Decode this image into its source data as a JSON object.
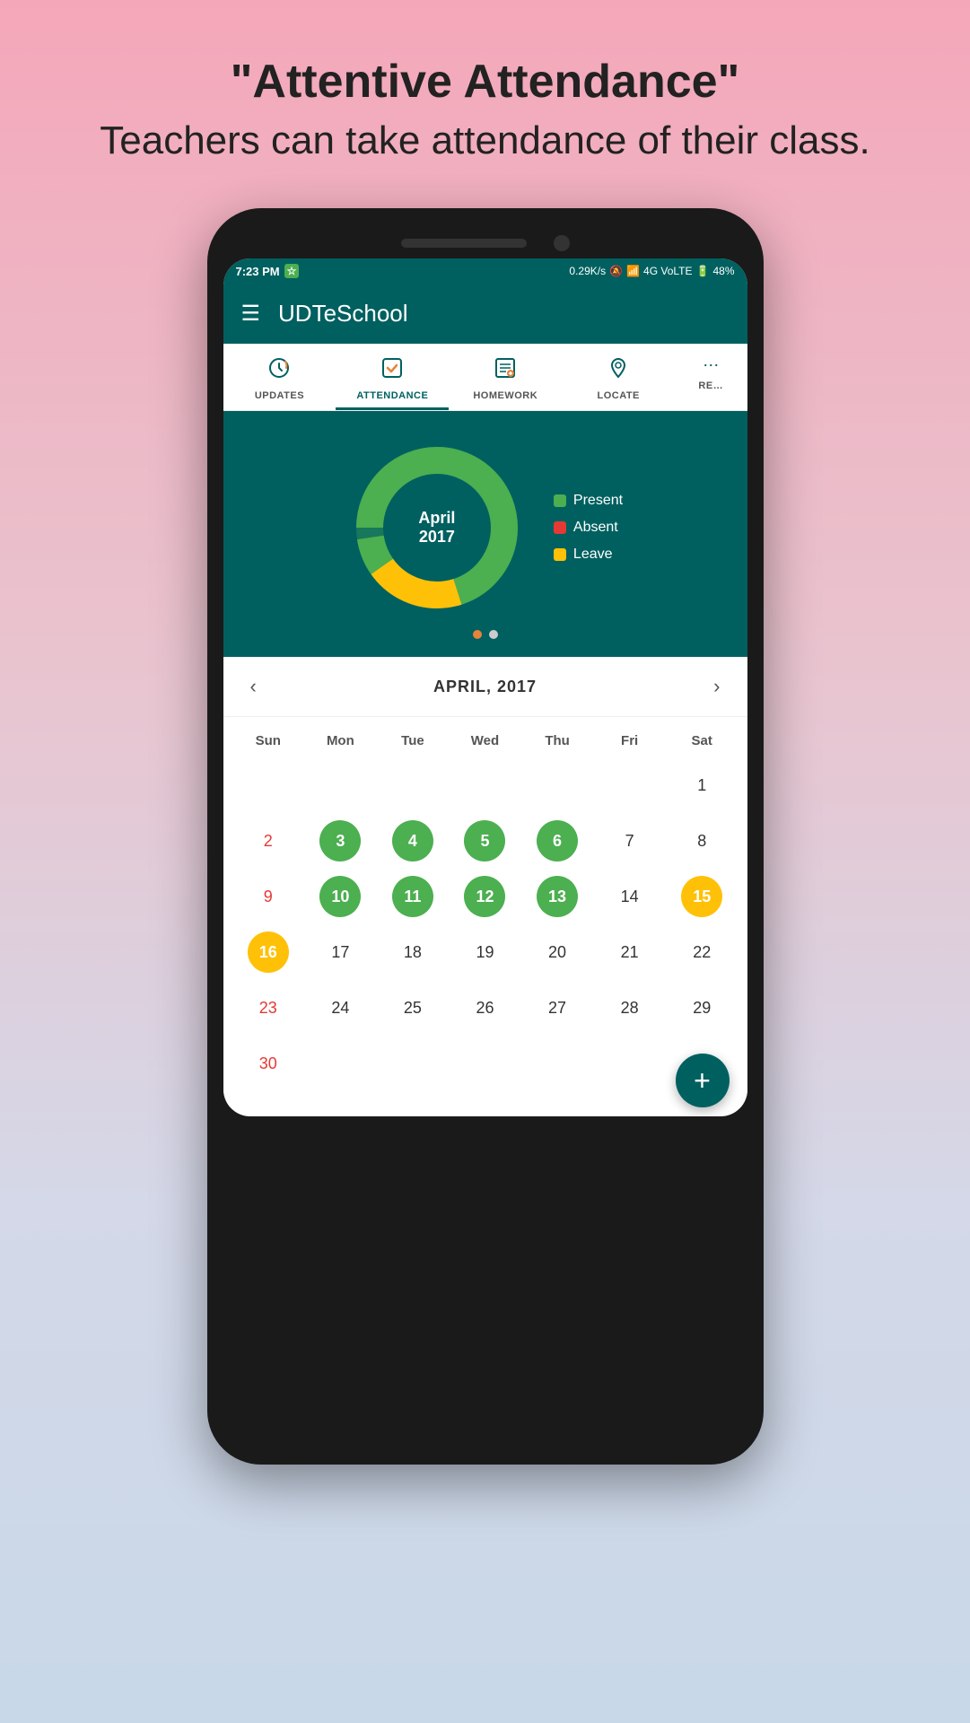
{
  "page": {
    "headline": "\"Attentive Attendance\"",
    "subheadline": "Teachers can take attendance of their class."
  },
  "status_bar": {
    "time": "7:23 PM",
    "signal_info": "0.29K/s",
    "network": "4G VoLTE",
    "battery": "48%"
  },
  "app": {
    "title": "UDTeSchool"
  },
  "nav_tabs": [
    {
      "id": "updates",
      "label": "UPDATES",
      "icon": "↻"
    },
    {
      "id": "attendance",
      "label": "ATTENDANCE",
      "icon": "✓"
    },
    {
      "id": "homework",
      "label": "HOMEWORK",
      "icon": "📋"
    },
    {
      "id": "locate",
      "label": "LOCATE",
      "icon": "📍"
    },
    {
      "id": "more",
      "label": "RE…",
      "icon": "≡"
    }
  ],
  "chart": {
    "month": "April",
    "year": "2017",
    "legend": [
      {
        "label": "Present",
        "color": "#4caf50"
      },
      {
        "label": "Absent",
        "color": "#e53935"
      },
      {
        "label": "Leave",
        "color": "#ffc107"
      }
    ],
    "dots": [
      true,
      false
    ]
  },
  "calendar": {
    "title": "APRIL, 2017",
    "prev_label": "‹",
    "next_label": "›",
    "headers": [
      "Sun",
      "Mon",
      "Tue",
      "Wed",
      "Thu",
      "Fri",
      "Sat"
    ],
    "weeks": [
      [
        {
          "day": "",
          "type": "empty"
        },
        {
          "day": "",
          "type": "empty"
        },
        {
          "day": "",
          "type": "empty"
        },
        {
          "day": "",
          "type": "empty"
        },
        {
          "day": "",
          "type": "empty"
        },
        {
          "day": "",
          "type": "empty"
        },
        {
          "day": "1",
          "type": "normal"
        }
      ],
      [
        {
          "day": "2",
          "type": "sunday"
        },
        {
          "day": "3",
          "type": "present"
        },
        {
          "day": "4",
          "type": "present"
        },
        {
          "day": "5",
          "type": "present"
        },
        {
          "day": "6",
          "type": "present"
        },
        {
          "day": "7",
          "type": "normal"
        },
        {
          "day": "8",
          "type": "normal"
        }
      ],
      [
        {
          "day": "9",
          "type": "sunday"
        },
        {
          "day": "10",
          "type": "present"
        },
        {
          "day": "11",
          "type": "present"
        },
        {
          "day": "12",
          "type": "present"
        },
        {
          "day": "13",
          "type": "present"
        },
        {
          "day": "14",
          "type": "normal"
        },
        {
          "day": "15",
          "type": "leave"
        }
      ],
      [
        {
          "day": "16",
          "type": "leave-sunday"
        },
        {
          "day": "17",
          "type": "normal"
        },
        {
          "day": "18",
          "type": "normal"
        },
        {
          "day": "19",
          "type": "normal"
        },
        {
          "day": "20",
          "type": "normal"
        },
        {
          "day": "21",
          "type": "normal"
        },
        {
          "day": "22",
          "type": "normal"
        }
      ],
      [
        {
          "day": "23",
          "type": "sunday"
        },
        {
          "day": "24",
          "type": "normal"
        },
        {
          "day": "25",
          "type": "normal"
        },
        {
          "day": "26",
          "type": "normal"
        },
        {
          "day": "27",
          "type": "normal"
        },
        {
          "day": "28",
          "type": "normal"
        },
        {
          "day": "29",
          "type": "normal"
        }
      ],
      [
        {
          "day": "30",
          "type": "sunday"
        },
        {
          "day": "",
          "type": "empty"
        },
        {
          "day": "",
          "type": "empty"
        },
        {
          "day": "",
          "type": "empty"
        },
        {
          "day": "",
          "type": "empty"
        },
        {
          "day": "",
          "type": "empty"
        },
        {
          "day": "",
          "type": "empty"
        }
      ]
    ]
  },
  "fab": {
    "label": "+"
  }
}
